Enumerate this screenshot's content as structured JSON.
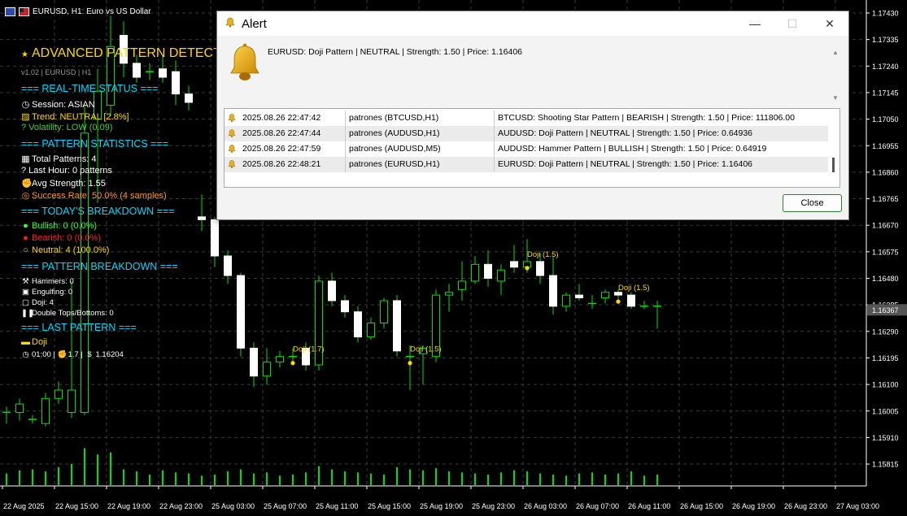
{
  "chart_data": {
    "type": "candlestick",
    "symbol_header": "EURUSD, H1:  Euro vs US Dollar",
    "y_ticks": [
      "1.17430",
      "1.17335",
      "1.17240",
      "1.17145",
      "1.17050",
      "1.16955",
      "1.16860",
      "1.16765",
      "1.16670",
      "1.16575",
      "1.16480",
      "1.16385",
      "1.16290",
      "1.16195",
      "1.16100",
      "1.16005",
      "1.15910",
      "1.15815"
    ],
    "current_price_label": "1.16367",
    "x_ticks": [
      "22 Aug 2025",
      "22 Aug 15:00",
      "22 Aug 19:00",
      "22 Aug 23:00",
      "25 Aug 03:00",
      "25 Aug 07:00",
      "25 Aug 11:00",
      "25 Aug 15:00",
      "25 Aug 19:00",
      "25 Aug 23:00",
      "26 Aug 03:00",
      "26 Aug 07:00",
      "26 Aug 11:00",
      "26 Aug 15:00",
      "26 Aug 19:00",
      "26 Aug 23:00",
      "27 Aug 03:00"
    ],
    "candles": [
      {
        "o": 1.16,
        "h": 1.1602,
        "l": 1.1596,
        "c": 1.16
      },
      {
        "o": 1.16,
        "h": 1.1605,
        "l": 1.1597,
        "c": 1.1603
      },
      {
        "o": 1.15975,
        "h": 1.1599,
        "l": 1.1596,
        "c": 1.15975
      },
      {
        "o": 1.1596,
        "h": 1.1607,
        "l": 1.1595,
        "c": 1.1605
      },
      {
        "o": 1.1605,
        "h": 1.1611,
        "l": 1.1603,
        "c": 1.1608
      },
      {
        "o": 1.16,
        "h": 1.1647,
        "l": 1.1598,
        "c": 1.1608
      },
      {
        "o": 1.16,
        "h": 1.171,
        "l": 1.1599,
        "c": 1.17
      },
      {
        "o": 1.1705,
        "h": 1.1723,
        "l": 1.1675,
        "c": 1.1715
      },
      {
        "o": 1.171,
        "h": 1.1742,
        "l": 1.1706,
        "c": 1.1731
      },
      {
        "o": 1.1735,
        "h": 1.174,
        "l": 1.172,
        "c": 1.1725
      },
      {
        "o": 1.1725,
        "h": 1.1728,
        "l": 1.1718,
        "c": 1.172
      },
      {
        "o": 1.1722,
        "h": 1.1725,
        "l": 1.1719,
        "c": 1.1722
      },
      {
        "o": 1.1723,
        "h": 1.1728,
        "l": 1.1718,
        "c": 1.172
      },
      {
        "o": 1.1722,
        "h": 1.1726,
        "l": 1.171,
        "c": 1.1714
      },
      {
        "o": 1.1714,
        "h": 1.1717,
        "l": 1.1708,
        "c": 1.1711
      },
      {
        "o": 1.167,
        "h": 1.1678,
        "l": 1.1665,
        "c": 1.1669
      },
      {
        "o": 1.1669,
        "h": 1.167,
        "l": 1.1652,
        "c": 1.1656
      },
      {
        "o": 1.1656,
        "h": 1.1658,
        "l": 1.1646,
        "c": 1.1649
      },
      {
        "o": 1.1649,
        "h": 1.165,
        "l": 1.162,
        "c": 1.1623
      },
      {
        "o": 1.1623,
        "h": 1.1625,
        "l": 1.1609,
        "c": 1.1613
      },
      {
        "o": 1.1613,
        "h": 1.1623,
        "l": 1.161,
        "c": 1.1618
      },
      {
        "o": 1.1618,
        "h": 1.1622,
        "l": 1.1616,
        "c": 1.162
      },
      {
        "o": 1.162,
        "h": 1.1623,
        "l": 1.1618,
        "c": 1.162
      },
      {
        "o": 1.1623,
        "h": 1.1625,
        "l": 1.1615,
        "c": 1.1617
      },
      {
        "o": 1.1617,
        "h": 1.1649,
        "l": 1.1615,
        "c": 1.1647
      },
      {
        "o": 1.1647,
        "h": 1.165,
        "l": 1.1638,
        "c": 1.164
      },
      {
        "o": 1.164,
        "h": 1.1642,
        "l": 1.1634,
        "c": 1.1636
      },
      {
        "o": 1.1636,
        "h": 1.1638,
        "l": 1.1625,
        "c": 1.1627
      },
      {
        "o": 1.1627,
        "h": 1.1634,
        "l": 1.1626,
        "c": 1.1632
      },
      {
        "o": 1.1632,
        "h": 1.1641,
        "l": 1.163,
        "c": 1.164
      },
      {
        "o": 1.164,
        "h": 1.1642,
        "l": 1.162,
        "c": 1.1622
      },
      {
        "o": 1.162,
        "h": 1.1624,
        "l": 1.1608,
        "c": 1.162
      },
      {
        "o": 1.1621,
        "h": 1.1624,
        "l": 1.161,
        "c": 1.1623
      },
      {
        "o": 1.162,
        "h": 1.1644,
        "l": 1.1618,
        "c": 1.1642
      },
      {
        "o": 1.1642,
        "h": 1.1646,
        "l": 1.1636,
        "c": 1.1643
      },
      {
        "o": 1.1644,
        "h": 1.1654,
        "l": 1.164,
        "c": 1.1647
      },
      {
        "o": 1.1647,
        "h": 1.1656,
        "l": 1.1646,
        "c": 1.1653
      },
      {
        "o": 1.1653,
        "h": 1.1658,
        "l": 1.1645,
        "c": 1.1648
      },
      {
        "o": 1.1647,
        "h": 1.1653,
        "l": 1.1642,
        "c": 1.1651
      },
      {
        "o": 1.1654,
        "h": 1.166,
        "l": 1.165,
        "c": 1.1652
      },
      {
        "o": 1.1652,
        "h": 1.1662,
        "l": 1.165,
        "c": 1.1654
      },
      {
        "o": 1.1654,
        "h": 1.1657,
        "l": 1.1646,
        "c": 1.1649
      },
      {
        "o": 1.1649,
        "h": 1.1656,
        "l": 1.1635,
        "c": 1.1638
      },
      {
        "o": 1.1638,
        "h": 1.1643,
        "l": 1.1636,
        "c": 1.1642
      },
      {
        "o": 1.1642,
        "h": 1.1646,
        "l": 1.164,
        "c": 1.1641
      },
      {
        "o": 1.1639,
        "h": 1.1642,
        "l": 1.1637,
        "c": 1.1639
      },
      {
        "o": 1.1641,
        "h": 1.1644,
        "l": 1.1639,
        "c": 1.1643
      },
      {
        "o": 1.1643,
        "h": 1.1644,
        "l": 1.164,
        "c": 1.1642
      },
      {
        "o": 1.1642,
        "h": 1.1643,
        "l": 1.1637,
        "c": 1.1638
      },
      {
        "o": 1.1638,
        "h": 1.164,
        "l": 1.1637,
        "c": 1.1638
      },
      {
        "o": 1.1638,
        "h": 1.164,
        "l": 1.163,
        "c": 1.1638
      }
    ],
    "volumes": [
      22,
      28,
      30,
      26,
      34,
      40,
      70,
      58,
      62,
      30,
      26,
      20,
      28,
      24,
      22,
      18,
      20,
      26,
      30,
      22,
      24,
      18,
      20,
      24,
      36,
      30,
      26,
      24,
      22,
      20,
      34,
      30,
      28,
      32,
      26,
      24,
      22,
      20,
      24,
      28,
      26,
      22,
      20,
      18,
      22,
      24,
      20,
      22,
      26,
      18,
      20
    ],
    "pattern_labels": [
      {
        "text": "Doji (1.7)",
        "candle": 22
      },
      {
        "text": "Doji (1.5)",
        "candle": 31
      },
      {
        "text": "Doji (1.5)",
        "candle": 40
      },
      {
        "text": "Doji (1.5)",
        "candle": 47
      }
    ],
    "colors": {
      "grid": "#2b2b2b",
      "up": "#00e000",
      "down": "#ffffff",
      "label": "#ffd800",
      "axis": "#ffffff"
    }
  },
  "overlay": {
    "title": "ADVANCED PATTERN DETECTOR",
    "version": "v1.02 | EURUSD | H1",
    "realtime_header": "=== REAL-TIME STATUS ===",
    "session": "Session: ASIAN",
    "trend": "Trend: NEUTRAL [2.8%]",
    "volatility": "? Volatility: LOW (0.09)",
    "stats_header": "=== PATTERN STATISTICS ===",
    "total": "Total Patterns: 4",
    "last_hour": "? Last Hour: 0 patterns",
    "avg": "Avg Strength: 1.55",
    "success": "Success Rate: 50.0% (4 samples)",
    "today_header": "=== TODAY'S BREAKDOWN ===",
    "bullish": "Bullish: 0 (0.0%)",
    "bearish": "Bearish: 0 (0.0%)",
    "neutral": "Neutral: 4 (100.0%)",
    "breakdown_header": "=== PATTERN BREAKDOWN ===",
    "hammers": "Hammers: 0",
    "engulfing": "Engulfing: 0",
    "doji": "Doji: 4",
    "double": "Double Tops/Bottoms: 0",
    "last_header": "=== LAST PATTERN ===",
    "last_name": "Doji",
    "last_time": "01:00 |",
    "last_strength": "1.7 |",
    "last_price": "1.16204",
    "colors": {
      "gold": "#ffd800",
      "cyan": "#00d8ff",
      "white": "#ffffff",
      "lime": "#33ff33",
      "green": "#44cc44",
      "orange": "#ff9a1a",
      "red": "#ff2020",
      "yellow": "#ffd800"
    }
  },
  "alert": {
    "title": "Alert",
    "message": "EURUSD: Doji Pattern | NEUTRAL | Strength: 1.50 | Price: 1.16406",
    "rows": [
      {
        "time": "2025.08.26 22:47:42",
        "source": "patrones (BTCUSD,H1)",
        "message": "BTCUSD: Shooting Star Pattern | BEARISH | Strength: 1.50 | Price: 111806.00"
      },
      {
        "time": "2025.08.26 22:47:44",
        "source": "patrones (AUDUSD,H1)",
        "message": "AUDUSD: Doji Pattern | NEUTRAL | Strength: 1.50 | Price: 0.64936"
      },
      {
        "time": "2025.08.26 22:47:59",
        "source": "patrones (AUDUSD,M5)",
        "message": "AUDUSD: Hammer Pattern | BULLISH | Strength: 1.50 | Price: 0.64919"
      },
      {
        "time": "2025.08.26 22:48:21",
        "source": "patrones (EURUSD,H1)",
        "message": "EURUSD: Doji Pattern | NEUTRAL | Strength: 1.50 | Price: 1.16406"
      }
    ],
    "close_label": "Close",
    "min_symbol": "—",
    "max_symbol": "☐",
    "close_symbol": "✕"
  }
}
